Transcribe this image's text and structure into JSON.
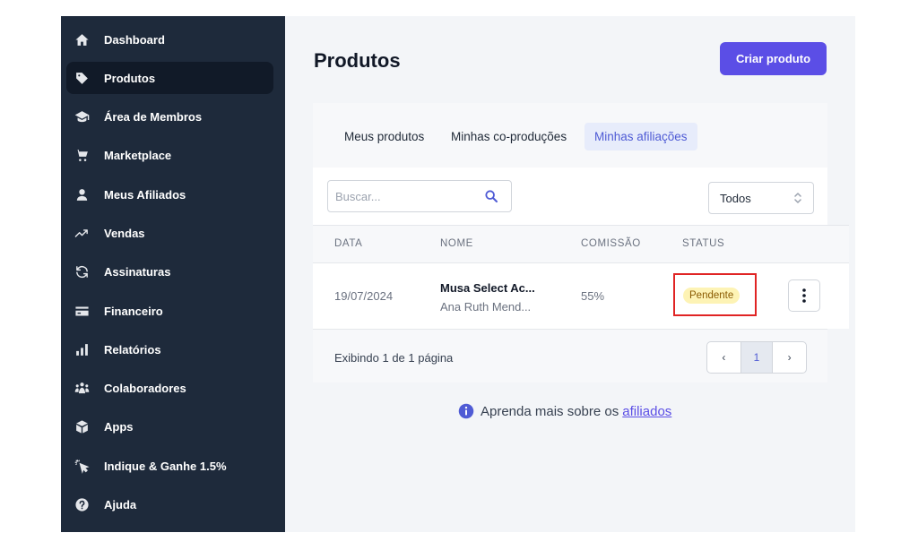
{
  "sidebar": {
    "items": [
      {
        "label": "Dashboard",
        "icon": "home-icon",
        "active": false
      },
      {
        "label": "Produtos",
        "icon": "tag-icon",
        "active": true
      },
      {
        "label": "Área de Membros",
        "icon": "graduation-cap-icon",
        "active": false
      },
      {
        "label": "Marketplace",
        "icon": "cart-icon",
        "active": false
      },
      {
        "label": "Meus Afiliados",
        "icon": "user-icon",
        "active": false
      },
      {
        "label": "Vendas",
        "icon": "trend-up-icon",
        "active": false
      },
      {
        "label": "Assinaturas",
        "icon": "refresh-icon",
        "active": false
      },
      {
        "label": "Financeiro",
        "icon": "credit-card-icon",
        "active": false
      },
      {
        "label": "Relatórios",
        "icon": "bar-chart-icon",
        "active": false
      },
      {
        "label": "Colaboradores",
        "icon": "users-icon",
        "active": false
      },
      {
        "label": "Apps",
        "icon": "box-icon",
        "active": false
      },
      {
        "label": "Indique & Ganhe 1.5%",
        "icon": "pointer-click-icon",
        "active": false
      },
      {
        "label": "Ajuda",
        "icon": "help-icon",
        "active": false
      }
    ]
  },
  "header": {
    "title": "Produtos",
    "create_label": "Criar produto"
  },
  "tabs": [
    {
      "label": "Meus produtos",
      "active": false
    },
    {
      "label": "Minhas co-produções",
      "active": false
    },
    {
      "label": "Minhas afiliações",
      "active": true
    }
  ],
  "filters": {
    "search_placeholder": "Buscar...",
    "status_select": "Todos"
  },
  "table": {
    "columns": [
      "DATA",
      "NOME",
      "COMISSÃO",
      "STATUS"
    ],
    "rows": [
      {
        "date": "19/07/2024",
        "name": "Musa Select Ac...",
        "owner": "Ana Ruth Mend...",
        "commission": "55%",
        "status": "Pendente"
      }
    ],
    "footer_info": "Exibindo 1 de 1 página",
    "pager": {
      "prev": "‹",
      "current": "1",
      "next": "›"
    }
  },
  "learn_more": {
    "text": "Aprenda mais sobre os",
    "link": "afiliados"
  },
  "colors": {
    "sidebar_bg": "#1e2a3b",
    "primary": "#5b4ee6",
    "badge_bg": "#fdf3b5",
    "highlight_border": "#e02424"
  }
}
